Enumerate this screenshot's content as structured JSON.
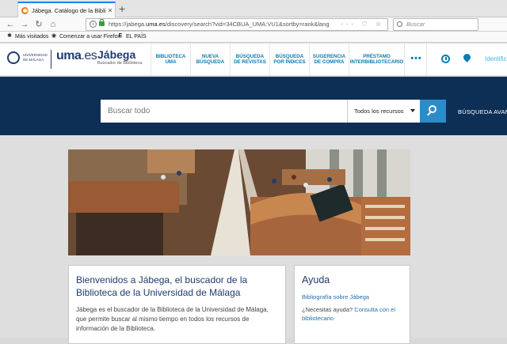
{
  "browser": {
    "tab_title": "Jábega. Catálogo de la Biblioteca",
    "new_tab": "+",
    "close": "×",
    "url_prefix": "https://jabega.",
    "url_host": "uma.es",
    "url_rest": "/discovery/search?vid=34CBUA_UMA:VU1&sortby=rank&lang",
    "url_actions": "··· ♡ ☆",
    "search_placeholder": "Buscar",
    "back": "←",
    "forward": "→",
    "reload": "↻",
    "home": "⌂",
    "bookmarks": [
      {
        "label": "Más visitados",
        "icon": "gear-icon",
        "glyph": "✱"
      },
      {
        "label": "Comenzar a usar Firefox",
        "icon": "firefox-icon",
        "glyph": "◉"
      },
      {
        "label": "EL PAÍS",
        "icon": "elpais-icon",
        "glyph": "E"
      }
    ]
  },
  "header": {
    "university_lines": [
      "UNIVERSIDAD",
      "DE MÁLAGA"
    ],
    "uma": "uma",
    "es": ".es",
    "jabega": "Jábega",
    "subtitle": "Buscador de Biblioteca",
    "nav": [
      "BIBLIOTECA UMA",
      "NUEVA BÚSQUEDA",
      "BÚSQUEDA DE REVISTAS",
      "BÚSQUEDA POR ÍNDICES",
      "SUGERENCIA DE COMPRA",
      "PRÉSTAMO INTERBIBLIOTECARIO"
    ],
    "more": "•••",
    "login": "Identificarse"
  },
  "search": {
    "placeholder": "Buscar todo",
    "scope": "Todos los recursos",
    "advanced": "BÚSQUEDA AVANZADA"
  },
  "welcome": {
    "title": "Bienvenidos a Jábega, el buscador de la Biblioteca de la Universidad de Málaga",
    "text": "Jábega es el buscador de la Biblioteca de la Universidad de Málaga, que permite buscar al mismo tiempo en todos los recursos de información de la Biblioteca."
  },
  "help": {
    "title": "Ayuda",
    "link1": "Bibliografía sobre Jábega",
    "question": "¿Necesitas ayuda?",
    "link2": "Consulta con el bibliotecario"
  },
  "colors": {
    "navy": "#0d2e55",
    "brand": "#1f3b6e",
    "nav_text": "#0b7bb0",
    "search_button": "#2b8dc8",
    "browser_accent": "#0a84ff"
  }
}
